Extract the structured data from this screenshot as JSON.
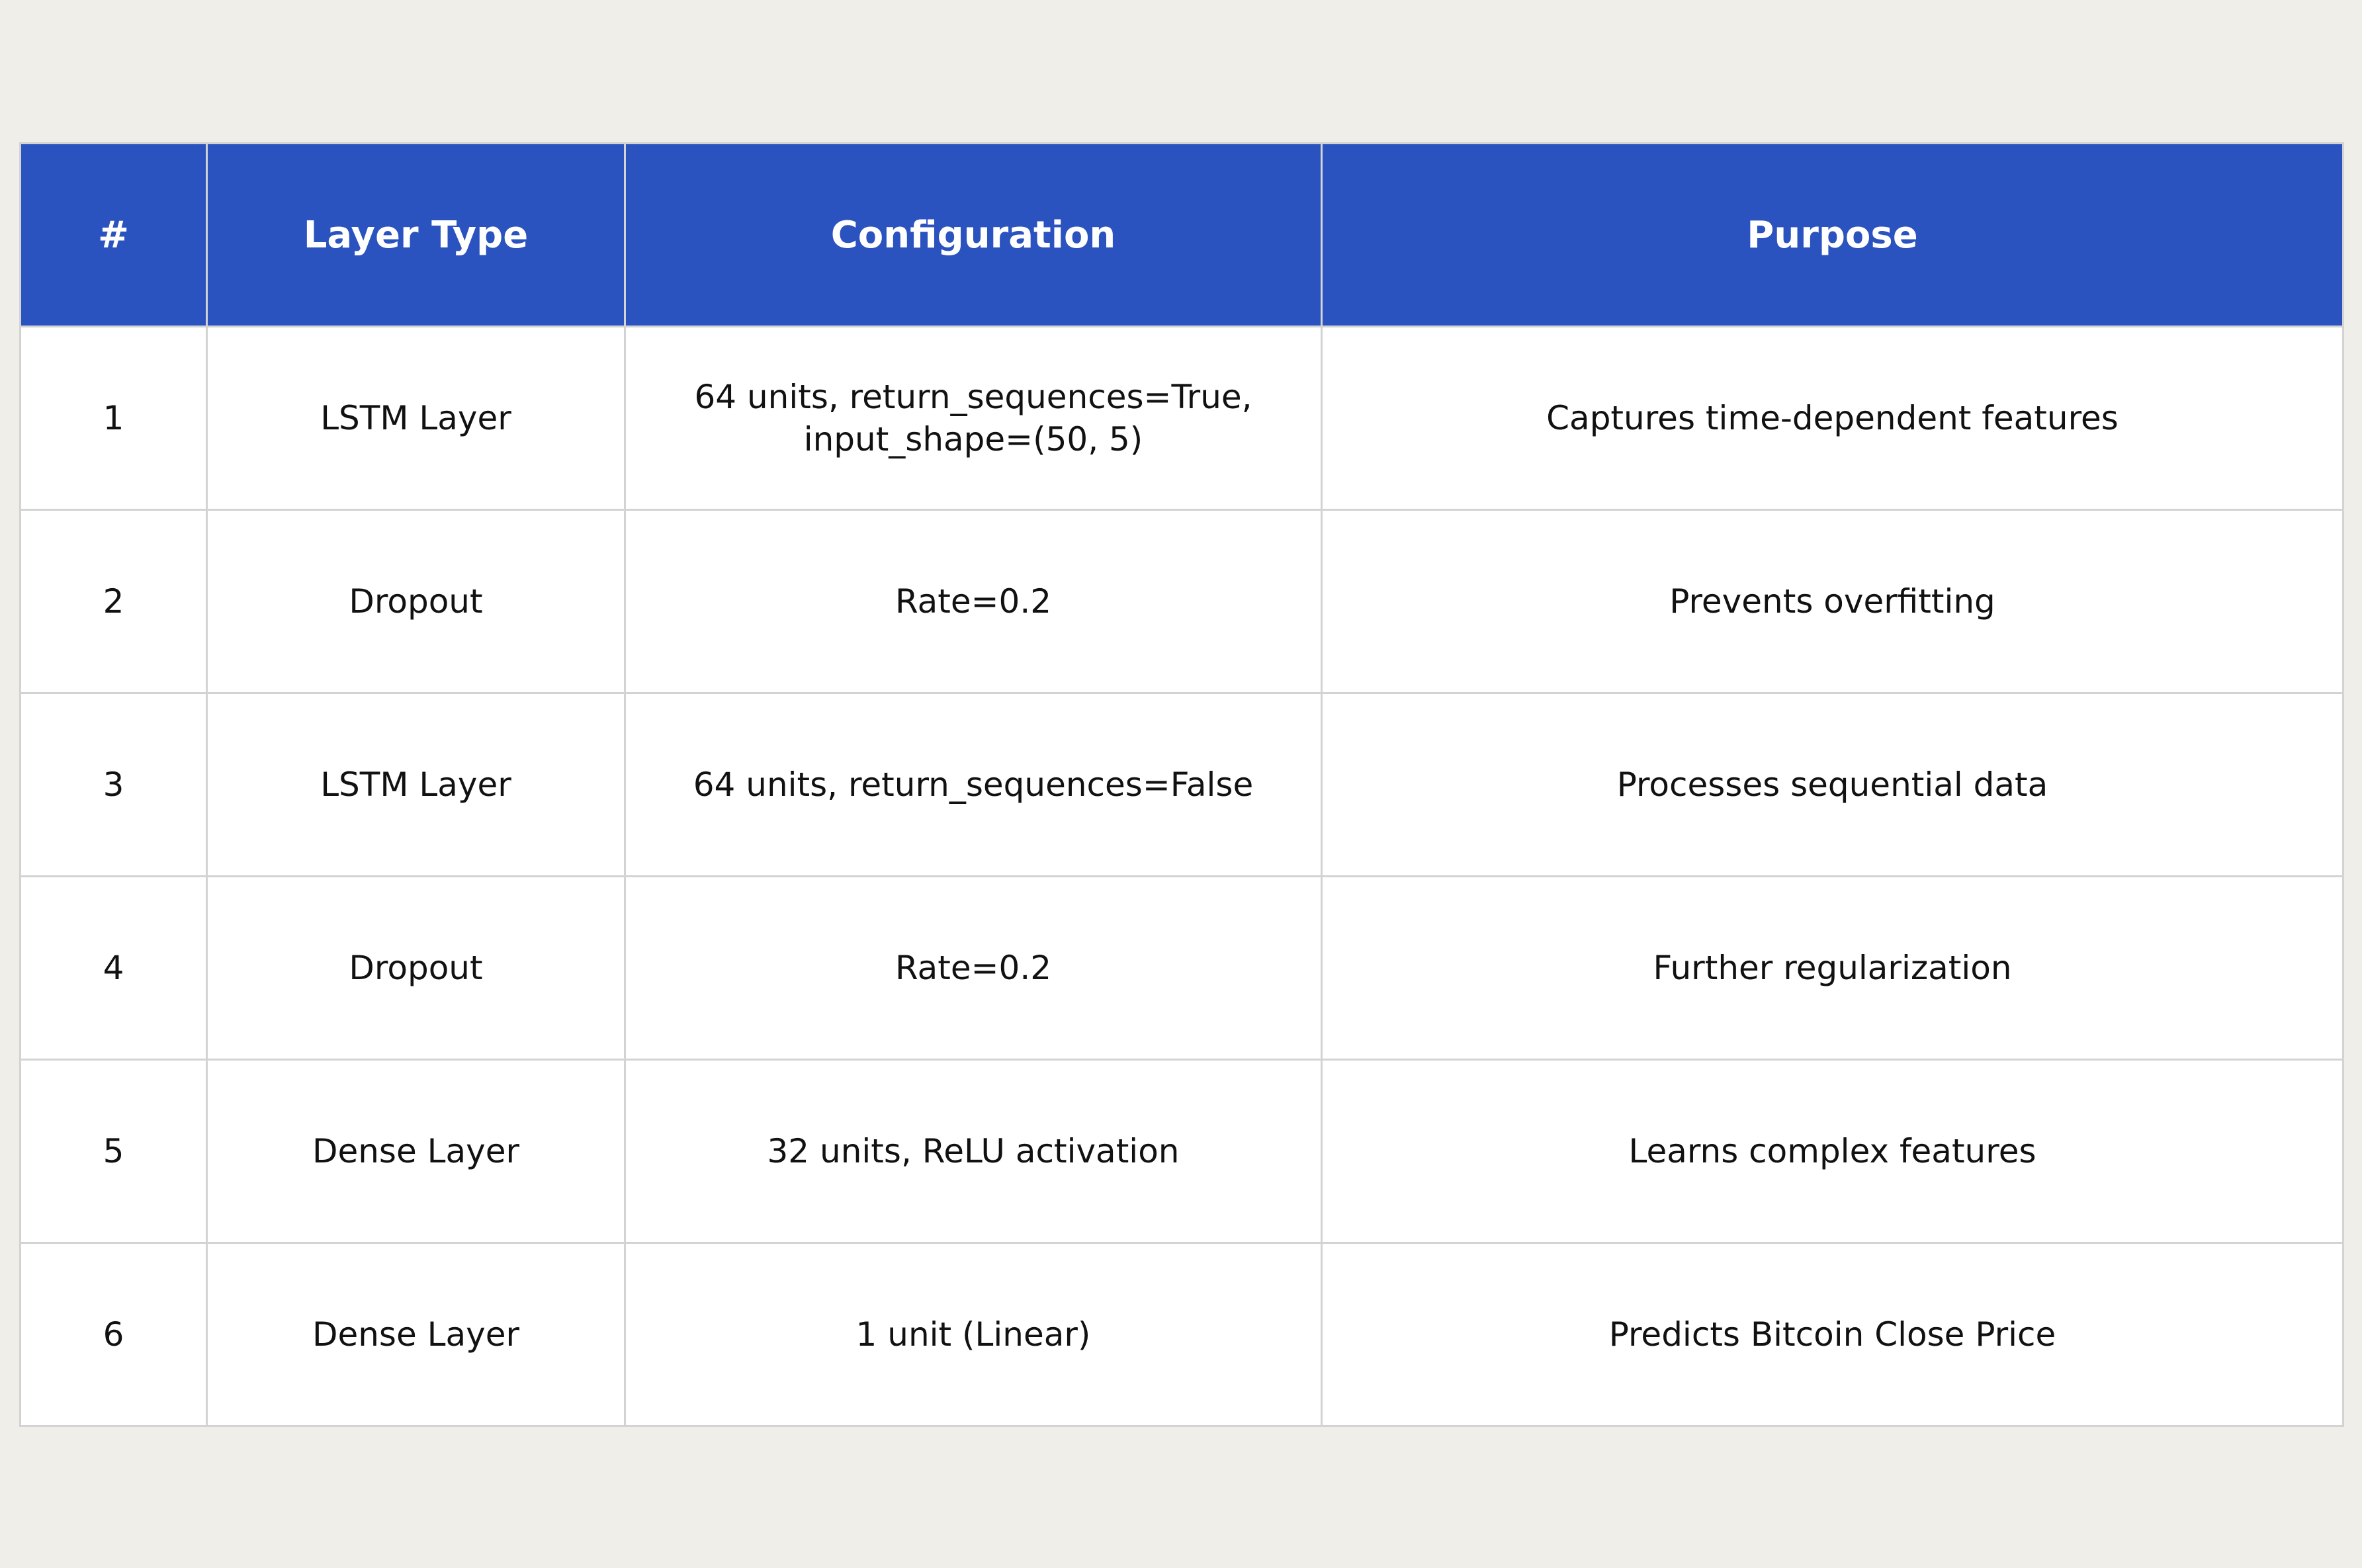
{
  "table": {
    "headers": [
      "#",
      "Layer Type",
      "Configuration",
      "Purpose"
    ],
    "rows": [
      [
        "1",
        "LSTM Layer",
        "64 units, return_sequences=True, input_shape=(50, 5)",
        "Captures time-dependent features"
      ],
      [
        "2",
        "Dropout",
        "Rate=0.2",
        "Prevents overfitting"
      ],
      [
        "3",
        "LSTM Layer",
        "64 units, return_sequences=False",
        "Processes sequential data"
      ],
      [
        "4",
        "Dropout",
        "Rate=0.2",
        "Further regularization"
      ],
      [
        "5",
        "Dense Layer",
        "32 units, ReLU activation",
        "Learns complex features"
      ],
      [
        "6",
        "Dense Layer",
        "1 unit (Linear)",
        "Predicts Bitcoin Close Price"
      ]
    ]
  },
  "colors": {
    "header_background": "#2a53bf",
    "header_text": "#ffffff",
    "page_background": "#efeee8",
    "grid_lines": "#d3d3d3"
  }
}
